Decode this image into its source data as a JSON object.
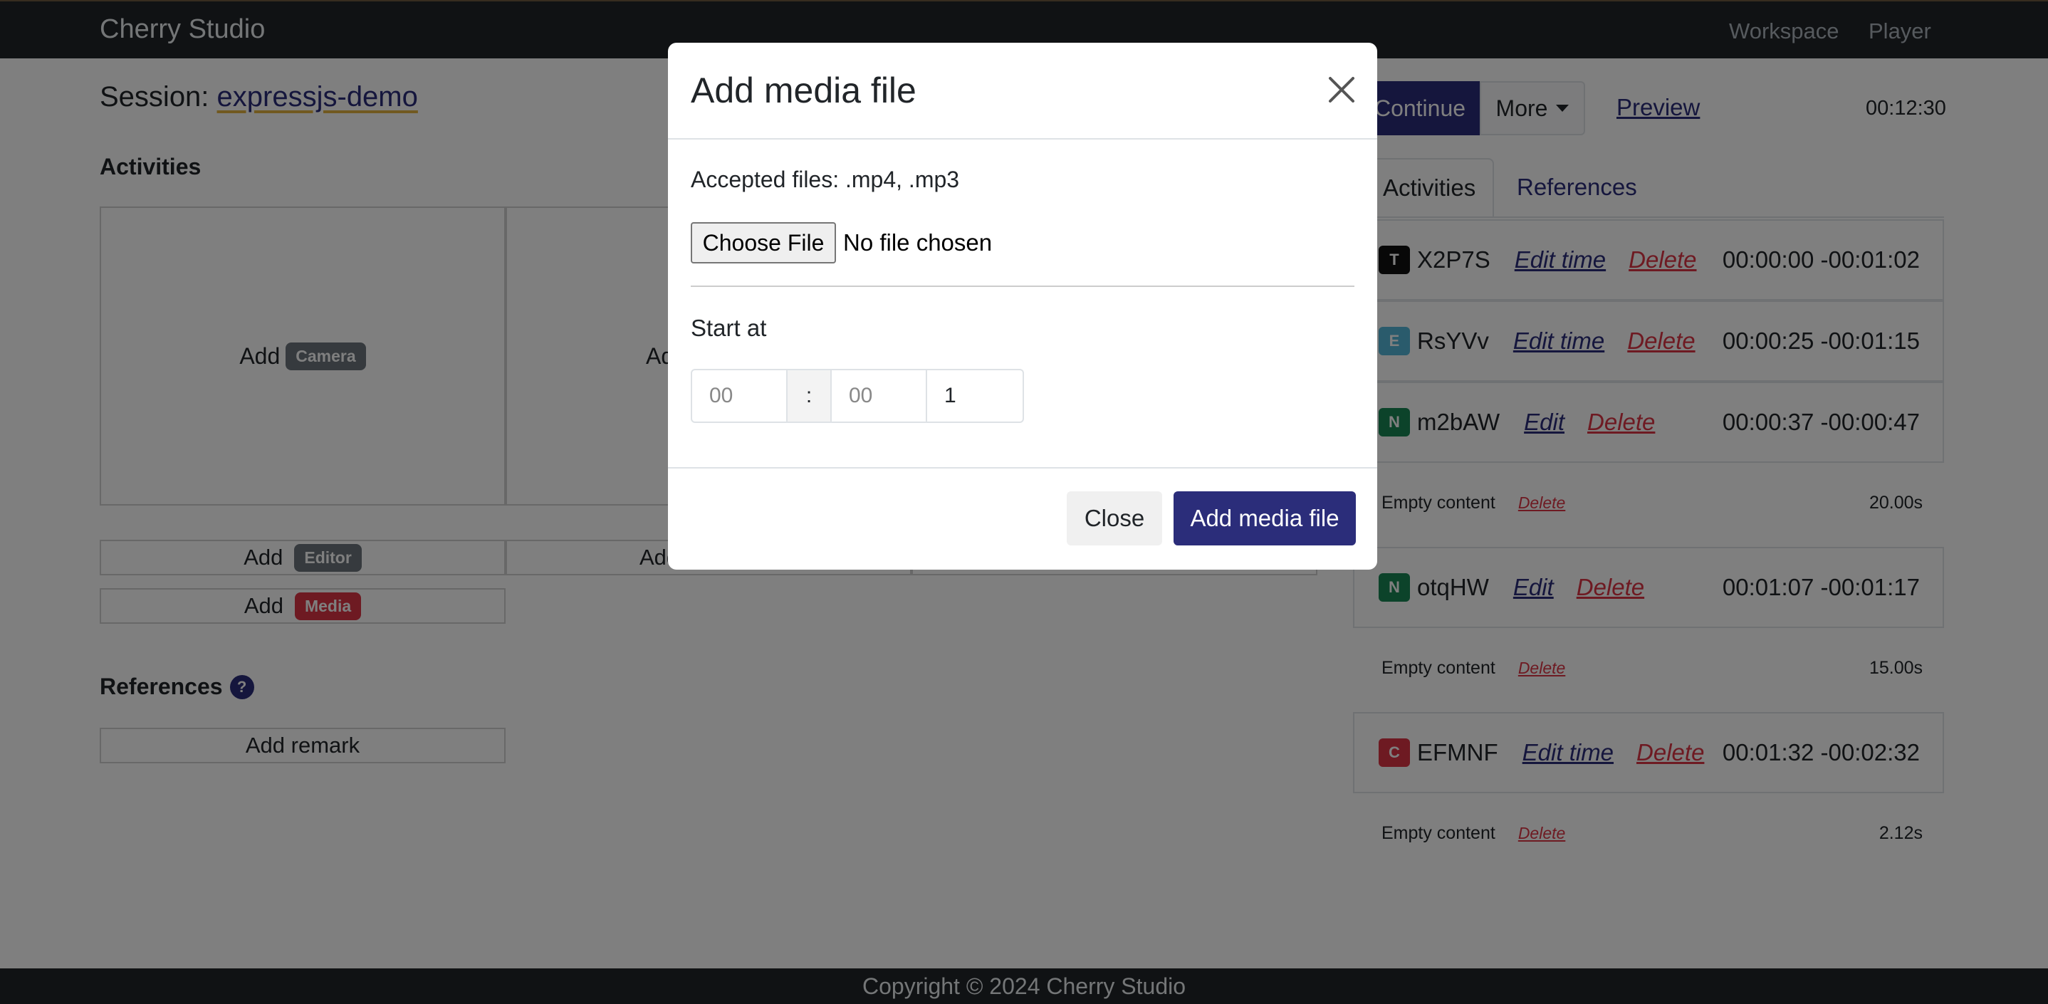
{
  "navbar": {
    "brand": "Cherry Studio",
    "links": [
      "Workspace",
      "Player"
    ]
  },
  "session": {
    "prefix": "Session:",
    "name": "expressjs-demo"
  },
  "activities": {
    "heading": "Activities",
    "add_word": "Add",
    "cards": [
      {
        "badge": "Camera",
        "color": "#6c757d"
      }
    ],
    "buttons": [
      {
        "badge": "Editor",
        "color": "#6c757d"
      },
      {
        "badge": "Media",
        "color": "#dc3545"
      }
    ],
    "partial_add": "Ad",
    "partial_add2": "Add"
  },
  "references": {
    "heading": "References",
    "help_icon": "question-circle-icon",
    "add_remark": "Add remark"
  },
  "toolbar": {
    "continue": "Continue",
    "more": "More",
    "preview": "Preview",
    "timer": "00:12:30"
  },
  "tabs": [
    "Activities",
    "References"
  ],
  "timeline": [
    {
      "badge": "T",
      "color": "#111111",
      "code": "X2P7S",
      "edit": "Edit time",
      "delete": "Delete",
      "time": "00:00:00 -00:01:02"
    },
    {
      "badge": "E",
      "color": "#55b7d9",
      "code": "RsYVv",
      "edit": "Edit time",
      "delete": "Delete",
      "time": "00:00:25 -00:01:15"
    },
    {
      "badge": "N",
      "color": "#198754",
      "code": "m2bAW",
      "edit": "Edit",
      "delete": "Delete",
      "time": "00:00:37 -00:00:47"
    },
    {
      "badge": "N",
      "color": "#198754",
      "code": "otqHW",
      "edit": "Edit",
      "delete": "Delete",
      "time": "00:01:07 -00:01:17"
    },
    {
      "badge": "C",
      "color": "#dc3545",
      "code": "EFMNF",
      "edit": "Edit time",
      "delete": "Delete",
      "time": "00:01:32 -00:02:32"
    }
  ],
  "sub_rows": [
    {
      "label": "Empty content",
      "delete": "Delete",
      "duration": "20.00s"
    },
    {
      "label": "Empty content",
      "delete": "Delete",
      "duration": "15.00s"
    },
    {
      "label": "Empty content",
      "delete": "Delete",
      "duration": "2.12s"
    }
  ],
  "footer": "Copyright © 2024 Cherry Studio",
  "modal": {
    "title": "Add media file",
    "accepted": "Accepted files: .mp4, .mp3",
    "choose_file": "Choose File",
    "no_file": "No file chosen",
    "start_at": "Start at",
    "hours_placeholder": "00",
    "separator": ":",
    "minutes_placeholder": "00",
    "seconds_value": "1",
    "close": "Close",
    "submit": "Add media file"
  }
}
